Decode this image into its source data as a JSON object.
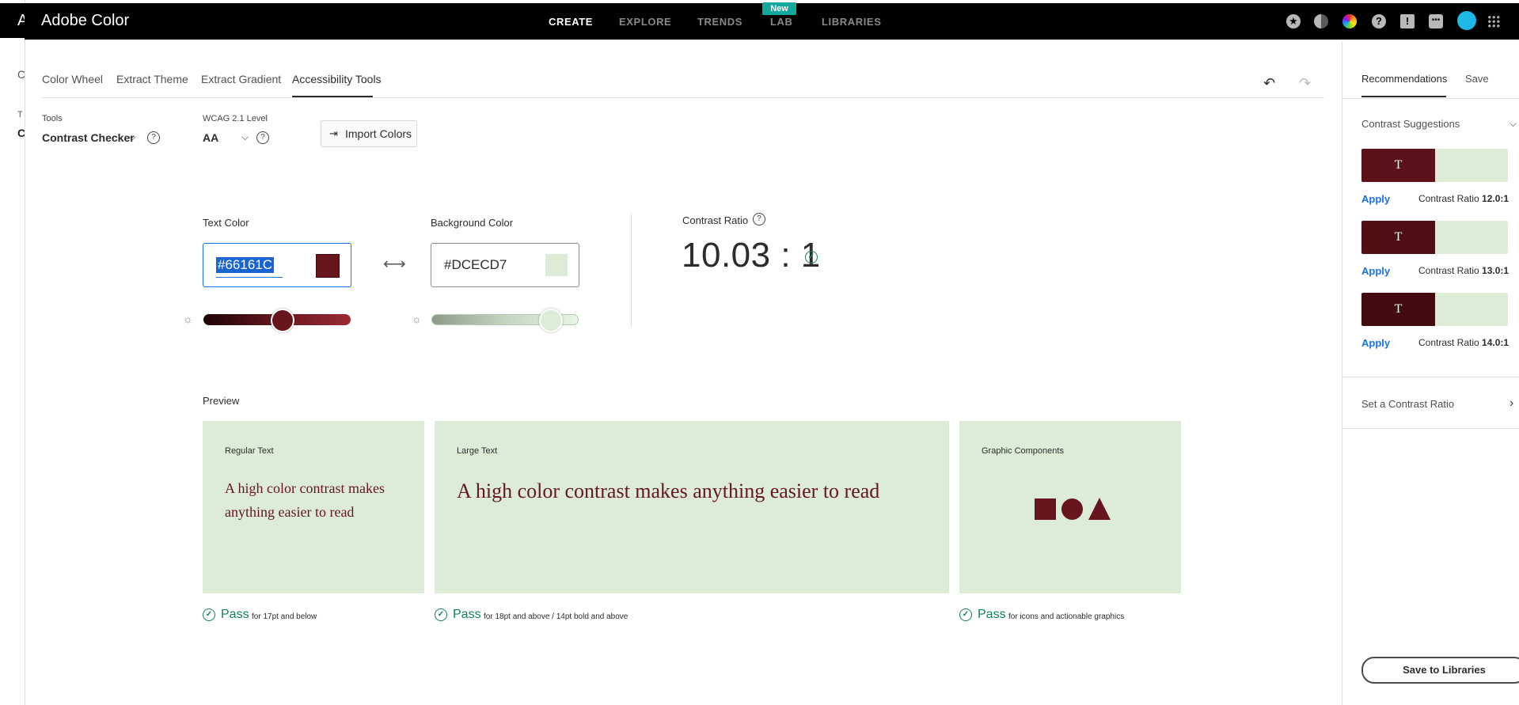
{
  "behind": {
    "letter_a": "A",
    "letter_c1": "C",
    "letter_t": "T",
    "letter_c2": "C"
  },
  "app": {
    "title": "Adobe Color"
  },
  "nav": {
    "items": [
      "CREATE",
      "EXPLORE",
      "TRENDS",
      "LAB",
      "LIBRARIES"
    ],
    "active": "CREATE",
    "badge": "New"
  },
  "tabs": [
    "Color Wheel",
    "Extract Theme",
    "Extract Gradient",
    "Accessibility Tools"
  ],
  "active_tab": "Accessibility Tools",
  "tools": {
    "label": "Tools",
    "value": "Contrast Checker",
    "wcag_label": "WCAG 2.1 Level",
    "wcag_value": "AA",
    "import_label": "Import Colors",
    "help": "?"
  },
  "checker": {
    "text_color_label": "Text Color",
    "text_color_value": "#66161C",
    "text_color_display": "#66161C",
    "text_slider": 0.53,
    "bg_color_label": "Background Color",
    "bg_color_value": "#DCECD7",
    "bg_slider": 0.85,
    "ratio_label": "Contrast Ratio",
    "ratio_value": "10.03 : 1"
  },
  "preview": {
    "label": "Preview",
    "cards": [
      {
        "title": "Regular Text",
        "sample": "A high color contrast makes anything easier to read",
        "pass": "Pass",
        "note": "for 17pt and below"
      },
      {
        "title": "Large Text",
        "sample": "A high color contrast makes anything easier to read",
        "pass": "Pass",
        "note": "for 18pt and above / 14pt bold and above"
      },
      {
        "title": "Graphic Components",
        "pass": "Pass",
        "note": "for icons and actionable graphics"
      }
    ]
  },
  "right_panel": {
    "tabs": [
      "Recommendations",
      "Save"
    ],
    "section_title": "Contrast Suggestions",
    "suggestions": [
      {
        "glyph": "T",
        "color": "#5c1218",
        "apply": "Apply",
        "ratio_prefix": "Contrast Ratio",
        "ratio": "12.0:1"
      },
      {
        "glyph": "T",
        "color": "#4f0f14",
        "apply": "Apply",
        "ratio_prefix": "Contrast Ratio",
        "ratio": "13.0:1"
      },
      {
        "glyph": "T",
        "color": "#410b10",
        "apply": "Apply",
        "ratio_prefix": "Contrast Ratio",
        "ratio": "14.0:1"
      }
    ],
    "set_ratio": "Set a Contrast Ratio",
    "save_button": "Save to Libraries"
  },
  "colors": {
    "text": "#66161C",
    "background": "#DCECD7",
    "pass_green": "#12805c",
    "link_blue": "#1473e6"
  }
}
